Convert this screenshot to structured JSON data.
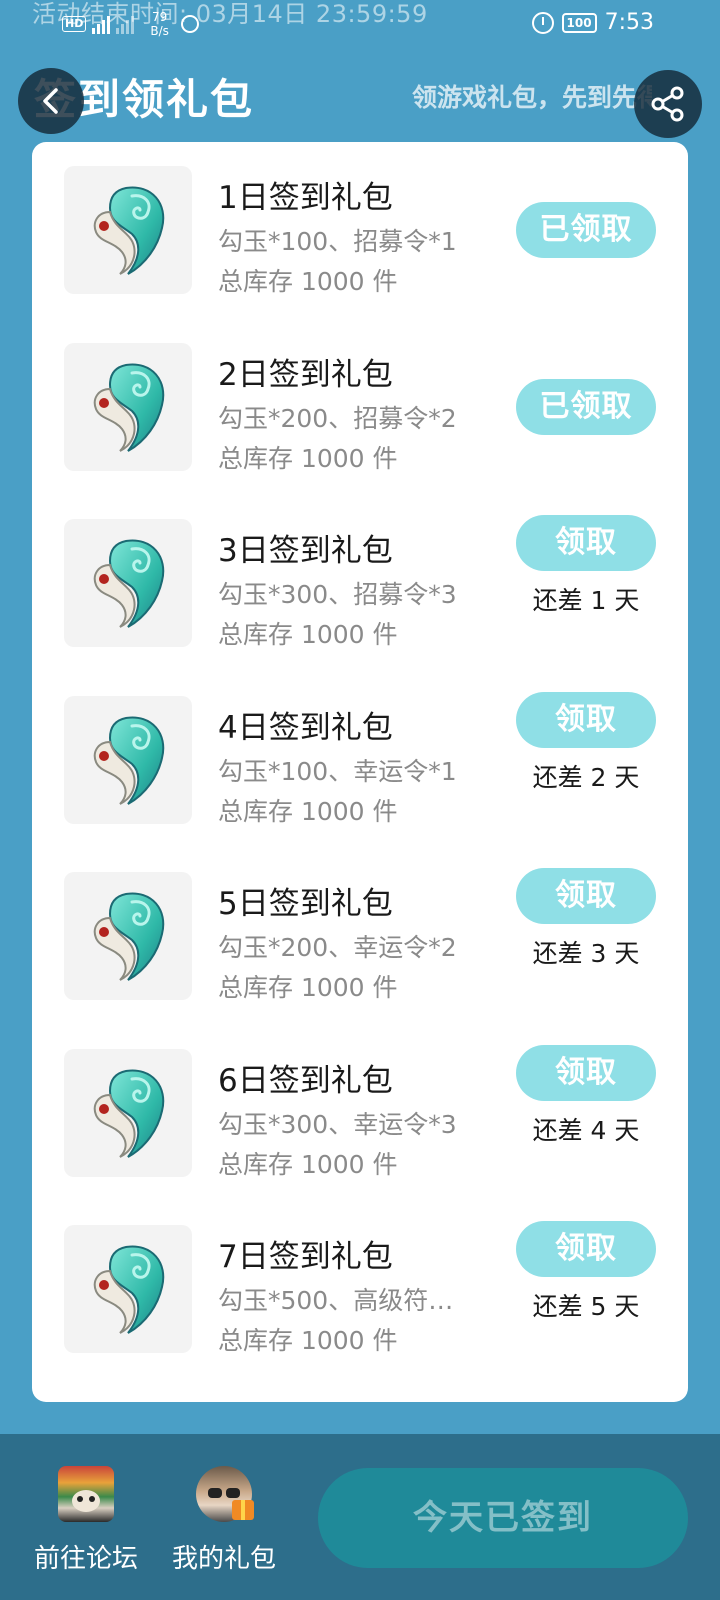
{
  "status_bar": {
    "activity_end": "活动结束时间: 03月14日 23:59:59",
    "hd": "HD",
    "net_speed": "79",
    "net_unit": "B/s",
    "battery": "100",
    "time": "7:53"
  },
  "header": {
    "title": "签到领礼包",
    "subtitle": "领游戏礼包，先到先得"
  },
  "gifts": [
    {
      "title": "1日签到礼包",
      "desc": "勾玉*100、招募令*1",
      "stock": "总库存 1000 件",
      "button": "已领取",
      "days_left": ""
    },
    {
      "title": "2日签到礼包",
      "desc": "勾玉*200、招募令*2",
      "stock": "总库存 1000 件",
      "button": "已领取",
      "days_left": ""
    },
    {
      "title": "3日签到礼包",
      "desc": "勾玉*300、招募令*3",
      "stock": "总库存 1000 件",
      "button": "领取",
      "days_left": "还差 1 天"
    },
    {
      "title": "4日签到礼包",
      "desc": "勾玉*100、幸运令*1",
      "stock": "总库存 1000 件",
      "button": "领取",
      "days_left": "还差 2 天"
    },
    {
      "title": "5日签到礼包",
      "desc": "勾玉*200、幸运令*2",
      "stock": "总库存 1000 件",
      "button": "领取",
      "days_left": "还差 3 天"
    },
    {
      "title": "6日签到礼包",
      "desc": "勾玉*300、幸运令*3",
      "stock": "总库存 1000 件",
      "button": "领取",
      "days_left": "还差 4 天"
    },
    {
      "title": "7日签到礼包",
      "desc": "勾玉*500、高级符…",
      "stock": "总库存 1000 件",
      "button": "领取",
      "days_left": "还差 5 天"
    }
  ],
  "bottom_bar": {
    "forum_label": "前往论坛",
    "my_gifts_label": "我的礼包",
    "signed_label": "今天已签到"
  },
  "colors": {
    "background": "#4a9fc6",
    "button": "#8fdfe6",
    "bottom_bar": "#2d6e8b",
    "signed_button": "#1f8a99"
  }
}
